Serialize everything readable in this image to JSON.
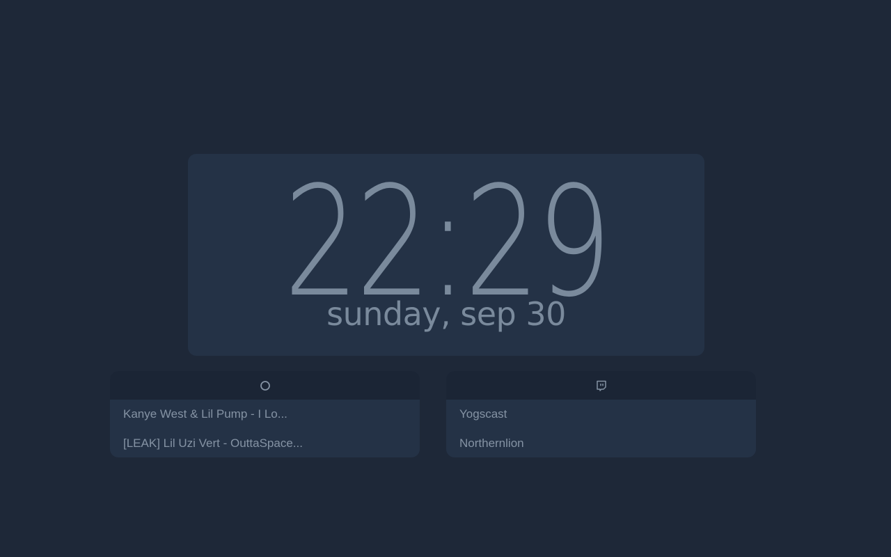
{
  "clock": {
    "time": "22:29",
    "date": "sunday, sep 30"
  },
  "widgets": {
    "music": {
      "icon": "circle-icon",
      "items": [
        {
          "label": "Kanye West & Lil Pump - I Lo..."
        },
        {
          "label": "[LEAK] Lil Uzi Vert - OuttaSpace..."
        }
      ]
    },
    "twitch": {
      "icon": "twitch-icon",
      "items": [
        {
          "label": "Yogscast"
        },
        {
          "label": "Northernlion"
        }
      ]
    }
  },
  "colors": {
    "background": "#1e2838",
    "card": "#243246",
    "header": "#1b2535",
    "text": "#7a8a9c"
  }
}
